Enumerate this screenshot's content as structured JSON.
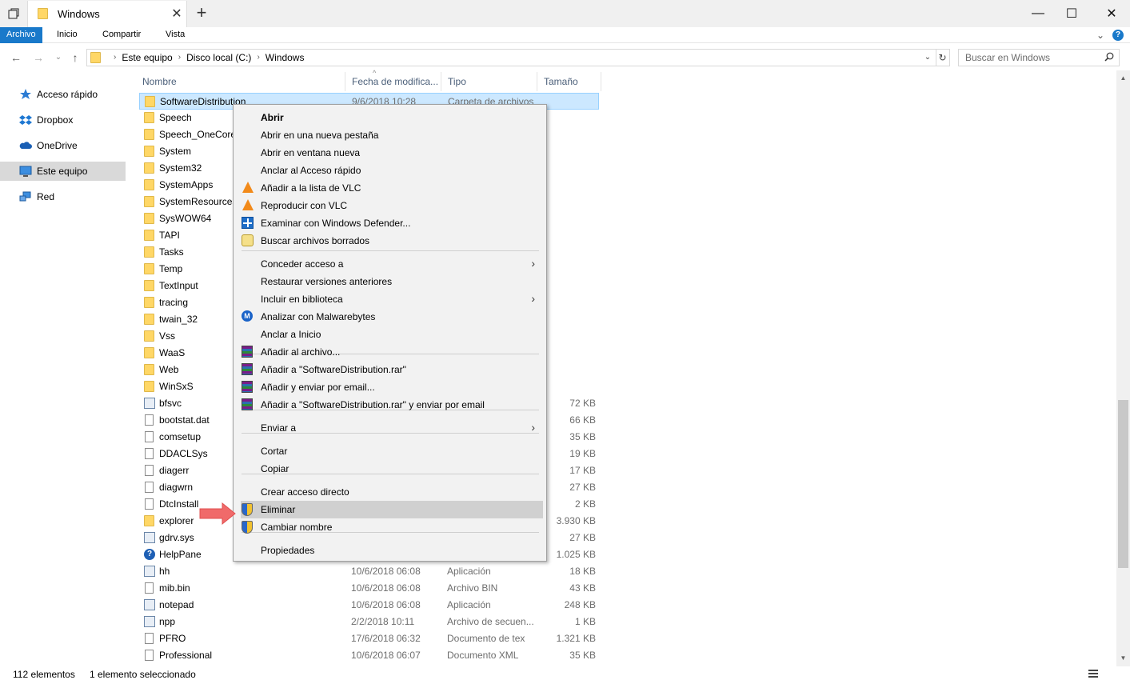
{
  "window": {
    "tab_title": "Windows",
    "close_tab": "✕",
    "new_tab": "+",
    "minimize": "—",
    "maximize": "☐",
    "close": "✕"
  },
  "ribbon": {
    "file": "Archivo",
    "home": "Inicio",
    "share": "Compartir",
    "view": "Vista",
    "expand": "⌄",
    "help": "?"
  },
  "nav": {
    "back": "←",
    "forward": "→",
    "recent": "⌄",
    "up": "↑",
    "breadcrumbs": [
      "Este equipo",
      "Disco local (C:)",
      "Windows"
    ],
    "search_placeholder": "Buscar en Windows"
  },
  "sidebar": {
    "items": [
      {
        "label": "Acceso rápido",
        "icon": "star-icon"
      },
      {
        "label": "Dropbox",
        "icon": "dropbox-icon"
      },
      {
        "label": "OneDrive",
        "icon": "cloud-icon"
      },
      {
        "label": "Este equipo",
        "icon": "computer-icon"
      },
      {
        "label": "Red",
        "icon": "network-icon"
      }
    ]
  },
  "columns": {
    "name": "Nombre",
    "date": "Fecha de modifica...",
    "type": "Tipo",
    "size": "Tamaño"
  },
  "files": [
    {
      "name": "SoftwareDistribution",
      "date": "9/6/2018 10:28",
      "type": "Carpeta de archivos",
      "size": "",
      "icon": "folder"
    },
    {
      "name": "Speech",
      "date": "",
      "type": "",
      "size": "",
      "icon": "folder"
    },
    {
      "name": "Speech_OneCore",
      "date": "",
      "type": "",
      "size": "",
      "icon": "folder"
    },
    {
      "name": "System",
      "date": "",
      "type": "",
      "size": "",
      "icon": "folder"
    },
    {
      "name": "System32",
      "date": "",
      "type": "",
      "size": "",
      "icon": "folder"
    },
    {
      "name": "SystemApps",
      "date": "",
      "type": "",
      "size": "",
      "icon": "folder"
    },
    {
      "name": "SystemResources",
      "date": "",
      "type": "",
      "size": "",
      "icon": "folder"
    },
    {
      "name": "SysWOW64",
      "date": "",
      "type": "",
      "size": "",
      "icon": "folder"
    },
    {
      "name": "TAPI",
      "date": "",
      "type": "",
      "size": "",
      "icon": "folder"
    },
    {
      "name": "Tasks",
      "date": "",
      "type": "",
      "size": "",
      "icon": "folder"
    },
    {
      "name": "Temp",
      "date": "",
      "type": "",
      "size": "",
      "icon": "folder"
    },
    {
      "name": "TextInput",
      "date": "",
      "type": "",
      "size": "",
      "icon": "folder"
    },
    {
      "name": "tracing",
      "date": "",
      "type": "",
      "size": "",
      "icon": "folder"
    },
    {
      "name": "twain_32",
      "date": "",
      "type": "",
      "size": "",
      "icon": "folder"
    },
    {
      "name": "Vss",
      "date": "",
      "type": "",
      "size": "",
      "icon": "folder"
    },
    {
      "name": "WaaS",
      "date": "",
      "type": "",
      "size": "",
      "icon": "folder"
    },
    {
      "name": "Web",
      "date": "",
      "type": "",
      "size": "",
      "icon": "folder"
    },
    {
      "name": "WinSxS",
      "date": "",
      "type": "",
      "size": "",
      "icon": "folder"
    },
    {
      "name": "bfsvc",
      "date": "",
      "type": "",
      "size": "72 KB",
      "icon": "app"
    },
    {
      "name": "bootstat.dat",
      "date": "",
      "type": "",
      "size": "66 KB",
      "icon": "doc"
    },
    {
      "name": "comsetup",
      "date": "",
      "type": "",
      "size": "35 KB",
      "icon": "doc"
    },
    {
      "name": "DDACLSys",
      "date": "",
      "type": "",
      "size": "19 KB",
      "icon": "doc"
    },
    {
      "name": "diagerr",
      "date": "",
      "type": "",
      "size": "17 KB",
      "icon": "doc"
    },
    {
      "name": "diagwrn",
      "date": "",
      "type": "",
      "size": "27 KB",
      "icon": "doc"
    },
    {
      "name": "DtcInstall",
      "date": "",
      "type": "",
      "size": "2 KB",
      "icon": "doc"
    },
    {
      "name": "explorer",
      "date": "",
      "type": "",
      "size": "3.930 KB",
      "icon": "folder"
    },
    {
      "name": "gdrv.sys",
      "date": "",
      "type": "",
      "size": "27 KB",
      "icon": "app"
    },
    {
      "name": "HelpPane",
      "date": "",
      "type": "",
      "size": "1.025 KB",
      "icon": "help"
    },
    {
      "name": "hh",
      "date": "10/6/2018 06:08",
      "type": "Aplicación",
      "size": "18 KB",
      "icon": "app"
    },
    {
      "name": "mib.bin",
      "date": "10/6/2018 06:08",
      "type": "Archivo BIN",
      "size": "43 KB",
      "icon": "doc"
    },
    {
      "name": "notepad",
      "date": "10/6/2018 06:08",
      "type": "Aplicación",
      "size": "248 KB",
      "icon": "app"
    },
    {
      "name": "npp",
      "date": "2/2/2018 10:11",
      "type": "Archivo de secuen...",
      "size": "1 KB",
      "icon": "app"
    },
    {
      "name": "PFRO",
      "date": "17/6/2018 06:32",
      "type": "Documento de tex",
      "size": "1.321 KB",
      "icon": "doc"
    },
    {
      "name": "Professional",
      "date": "10/6/2018 06:07",
      "type": "Documento XML",
      "size": "35 KB",
      "icon": "doc"
    }
  ],
  "context_menu": {
    "items": [
      {
        "label": "Abrir",
        "icon": "",
        "submenu": false,
        "bold": true
      },
      {
        "label": "Abrir en una nueva pestaña",
        "icon": "",
        "submenu": false
      },
      {
        "label": "Abrir en ventana nueva",
        "icon": "",
        "submenu": false
      },
      {
        "label": "Anclar al Acceso rápido",
        "icon": "",
        "submenu": false
      },
      {
        "label": "Añadir a la lista de VLC",
        "icon": "vlc",
        "submenu": false
      },
      {
        "label": "Reproducir con VLC",
        "icon": "vlc",
        "submenu": false
      },
      {
        "label": "Examinar con Windows Defender...",
        "icon": "defender",
        "submenu": false
      },
      {
        "label": "Buscar archivos borrados",
        "icon": "recuva",
        "submenu": false
      },
      {
        "label": "Conceder acceso a",
        "icon": "",
        "submenu": true
      },
      {
        "label": "Restaurar versiones anteriores",
        "icon": "",
        "submenu": false
      },
      {
        "label": "Incluir en biblioteca",
        "icon": "",
        "submenu": true
      },
      {
        "label": "Analizar con Malwarebytes",
        "icon": "malware",
        "submenu": false
      },
      {
        "label": "Anclar a Inicio",
        "icon": "",
        "submenu": false
      },
      {
        "label": "Añadir al archivo...",
        "icon": "winrar",
        "submenu": false
      },
      {
        "label": "Añadir a \"SoftwareDistribution.rar\"",
        "icon": "winrar",
        "submenu": false
      },
      {
        "label": "Añadir y enviar por email...",
        "icon": "winrar",
        "submenu": false
      },
      {
        "label": "Añadir a \"SoftwareDistribution.rar\" y enviar por email",
        "icon": "winrar",
        "submenu": false
      },
      {
        "label": "Enviar a",
        "icon": "",
        "submenu": true
      },
      {
        "label": "Cortar",
        "icon": "",
        "submenu": false
      },
      {
        "label": "Copiar",
        "icon": "",
        "submenu": false
      },
      {
        "label": "Crear acceso directo",
        "icon": "",
        "submenu": false
      },
      {
        "label": "Eliminar",
        "icon": "shield",
        "submenu": false,
        "highlighted": true
      },
      {
        "label": "Cambiar nombre",
        "icon": "shield",
        "submenu": false
      },
      {
        "label": "Propiedades",
        "icon": "",
        "submenu": false
      }
    ]
  },
  "status": {
    "count": "112 elementos",
    "selected": "1 elemento seleccionado"
  },
  "colors": {
    "accent": "#1979ca",
    "selection": "#cce8ff",
    "arrow": "#f06a6a"
  }
}
